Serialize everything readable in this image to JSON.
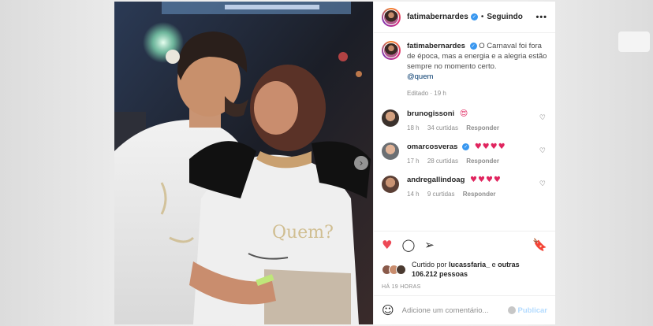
{
  "post": {
    "username": "fatimabernardes",
    "follow_label": "Seguindo",
    "separator": "•",
    "more_icon": "more-options-icon",
    "more_glyph": "•••",
    "verified_glyph": "✓",
    "caption_user": "fatimabernardes",
    "caption_text": "O Carnaval foi fora de época, mas a energia e a alegria estão sempre no momento certo.",
    "caption_mention": "@quem",
    "edited_label": "Editado",
    "edited_dot": "·",
    "edited_time": "19 h",
    "next_glyph": "›"
  },
  "comments": [
    {
      "user": "brunogissoni",
      "emoji": "😍",
      "time": "18 h",
      "likes": "34 curtidas",
      "reply": "Responder",
      "verified": false
    },
    {
      "user": "omarcosveras",
      "emoji": "♥♥♥♥",
      "time": "17 h",
      "likes": "28 curtidas",
      "reply": "Responder",
      "verified": true
    },
    {
      "user": "andregallindoag",
      "emoji": "♥♥♥♥",
      "time": "14 h",
      "likes": "9 curtidas",
      "reply": "Responder",
      "verified": false
    }
  ],
  "comment_heart_glyph": "♡",
  "actions": {
    "like_glyph": "♥",
    "comment_glyph": "◯",
    "share_glyph": "➢",
    "save_glyph": "🔖",
    "liked_prefix": "Curtido por",
    "liked_user": "lucassfaria_",
    "liked_and": "e",
    "liked_others": "outras 106.212 pessoas",
    "time_ago": "HÁ 19 HORAS"
  },
  "compose": {
    "smile_glyph": "☺",
    "placeholder": "Adicione um comentário...",
    "publish_label": "Publicar"
  },
  "colors": {
    "like_red": "#ed4956",
    "verified_blue": "#3897f0",
    "link_blue": "#00376b",
    "publish_disabled": "#b3dbff"
  }
}
